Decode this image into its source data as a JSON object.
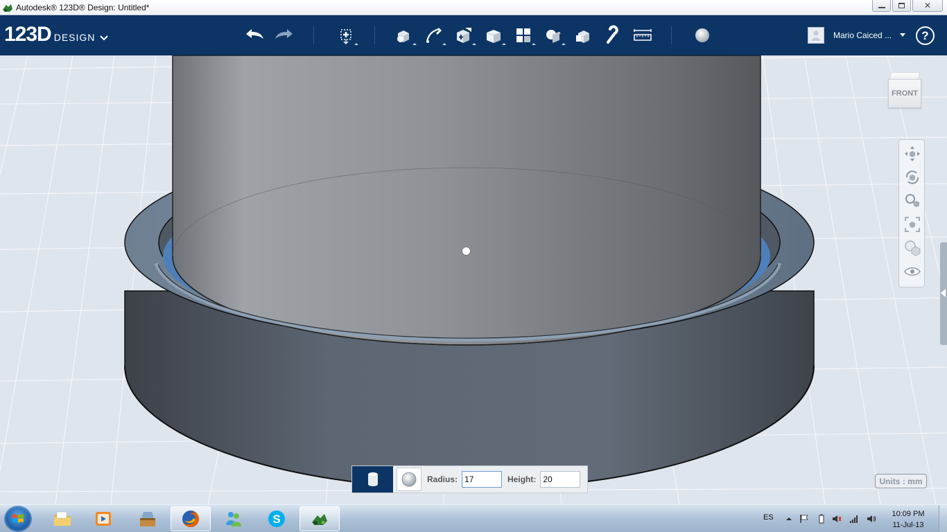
{
  "window": {
    "title": "Autodesk® 123D® Design: Untitled*",
    "controls": {
      "minimize": "—",
      "maximize": "□",
      "close": "✕"
    }
  },
  "toolbar": {
    "brand_logo": "123D",
    "brand_word": "DESIGN",
    "tools": [
      "undo-icon",
      "redo-icon",
      "transform-icon",
      "primitives-icon",
      "sketch-icon",
      "construct-icon",
      "modify-icon",
      "pattern-icon",
      "grouping-icon",
      "combine-icon",
      "snap-icon",
      "measure-icon",
      "material-icon"
    ],
    "user_name": "Mario Caiced ...",
    "help_label": "?"
  },
  "viewport": {
    "viewcube_label": "FRONT",
    "nav_tools": [
      "pan-icon",
      "orbit-icon",
      "zoom-icon",
      "fit-icon",
      "view-mode-icon",
      "visibility-icon"
    ],
    "units_label": "Units : mm"
  },
  "primitive_panel": {
    "shape": "cylinder-icon",
    "alt_shape": "sphere-icon",
    "radius_label": "Radius:",
    "radius_value": "17",
    "height_label": "Height:",
    "height_value": "20"
  },
  "taskbar": {
    "apps": [
      "file-explorer-icon",
      "media-player-icon",
      "toolbox-icon",
      "firefox-icon",
      "messenger-icon",
      "skype-icon",
      "123d-design-icon"
    ],
    "tray_lang": "ES",
    "clock_time": "10:09 PM",
    "clock_date": "11-Jul-13"
  },
  "colors": {
    "toolbar_bg": "#0c3566",
    "viewport_bg": "#dfe5ec",
    "model_gray": "#8d9096",
    "ring_blue": "#4f7fb8"
  }
}
